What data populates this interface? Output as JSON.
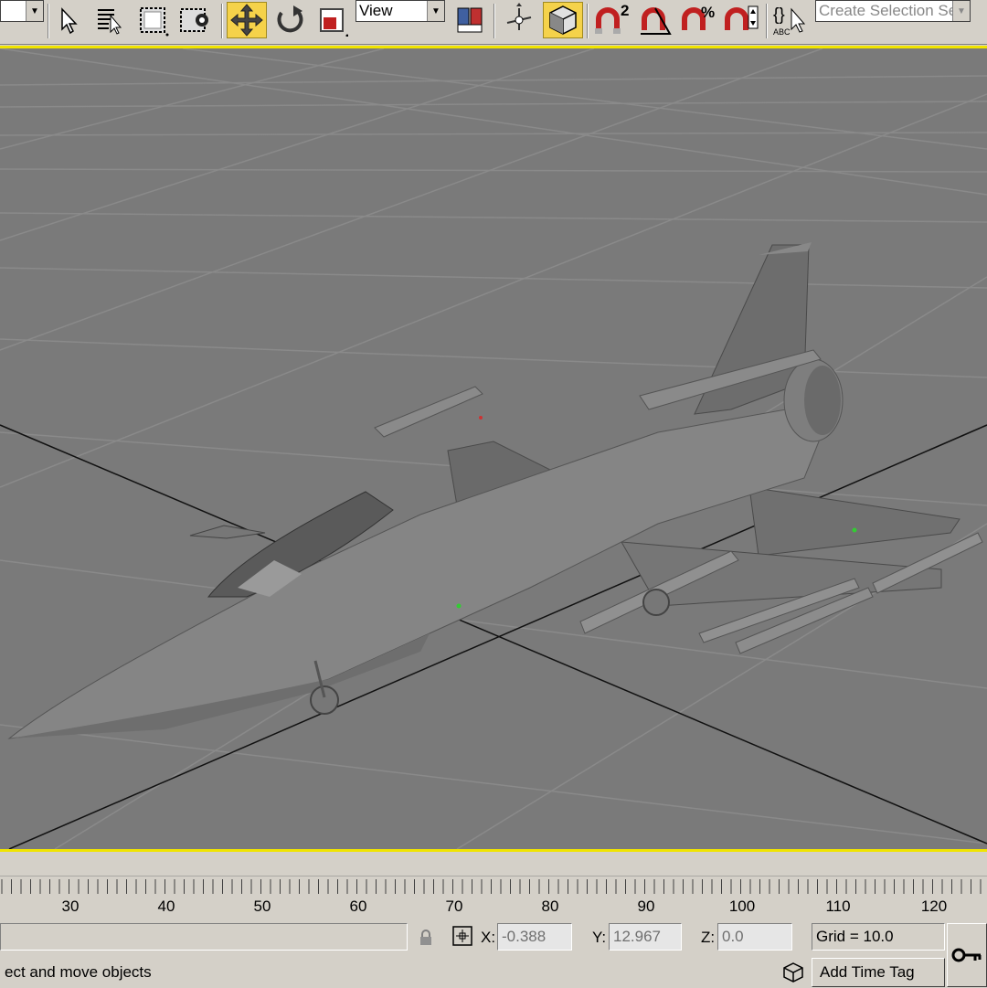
{
  "toolbar": {
    "view_dropdown": "View",
    "selection_set_placeholder": "Create Selection Set",
    "snap_2d_label": "2",
    "abc_label": "ABC",
    "icons": [
      "select-object-icon",
      "select-by-name-icon",
      "rectangle-region-icon",
      "window-crossing-icon",
      "select-move-icon",
      "select-rotate-icon",
      "select-scale-icon",
      "mirror-icon",
      "select-pivot-icon",
      "manipulate-icon",
      "snaps-toggle-icon",
      "angle-snap-icon",
      "percent-snap-icon",
      "spinner-snap-icon",
      "named-selection-icon"
    ]
  },
  "viewport": {
    "background": "#7a7a7a",
    "border_color": "#f0e400",
    "model": "fighter-jet"
  },
  "timeline": {
    "ticks": [
      "30",
      "40",
      "50",
      "60",
      "70",
      "80",
      "90",
      "100",
      "110",
      "120"
    ]
  },
  "status": {
    "prompt": "ect and move objects",
    "x_label": "X:",
    "x_value": "-0.388",
    "y_label": "Y:",
    "y_value": "12.967",
    "z_label": "Z:",
    "z_value": "0.0",
    "grid": "Grid = 10.0",
    "add_time_tag": "Add Time Tag"
  }
}
